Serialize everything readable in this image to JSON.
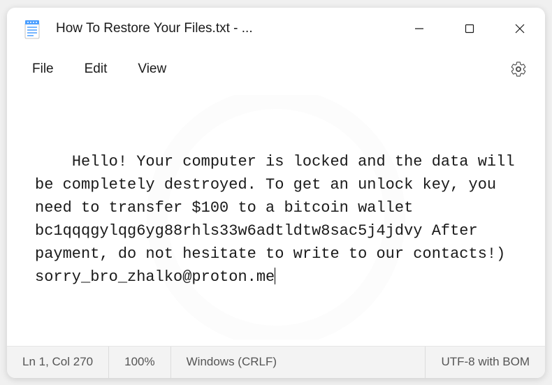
{
  "titlebar": {
    "title": "How To Restore Your Files.txt - ..."
  },
  "menu": {
    "file": "File",
    "edit": "Edit",
    "view": "View"
  },
  "content": {
    "text": "Hello! Your computer is locked and the data will be completely destroyed. To get an unlock key, you need to transfer $100 to a bitcoin wallet bc1qqqgylqg6yg88rhls33w6adtldtw8sac5j4jdvy After payment, do not hesitate to write to our contacts!) sorry_bro_zhalko@proton.me"
  },
  "statusbar": {
    "position": "Ln 1, Col 270",
    "zoom": "100%",
    "line_ending": "Windows (CRLF)",
    "encoding": "UTF-8 with BOM"
  }
}
